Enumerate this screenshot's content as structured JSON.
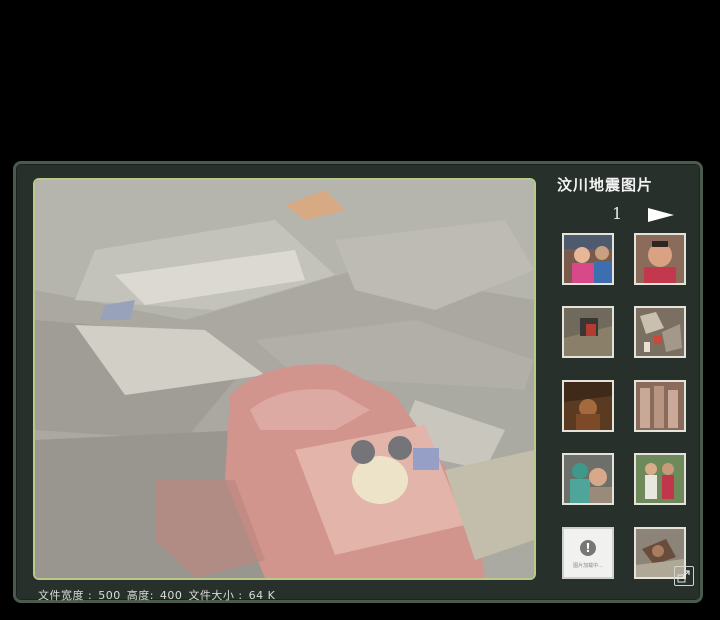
{
  "gallery": {
    "title": "汶川地震图片",
    "page": "1",
    "next_icon": "play-arrow-icon",
    "caption": {
      "width_label": "文件宽度 :",
      "width_value": "500",
      "height_label": "高度:",
      "height_value": "400",
      "size_label": "文件大小 :",
      "size_value": "64 K"
    },
    "main_image": "earthquake-rubble-backpack",
    "thumbnails": [
      "girl-smiling",
      "crying-woman",
      "rubble-rescue",
      "debris-closeup",
      "trapped-person",
      "covered-bodies",
      "medical-aid",
      "family-group",
      "image-unavailable",
      "rubble-figure"
    ],
    "placeholder_text": "图片加载中...",
    "fullscreen_icon": "expand-icon"
  }
}
